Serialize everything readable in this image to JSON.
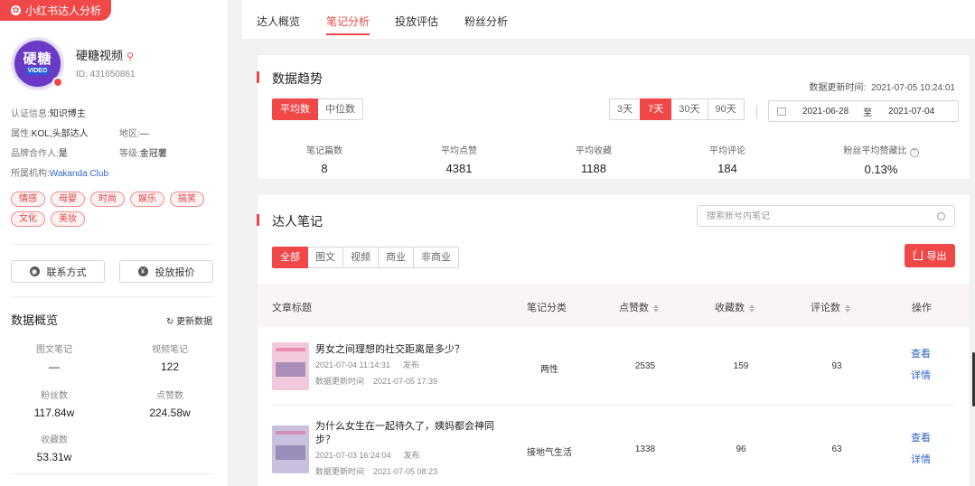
{
  "app": {
    "tag": "小红书达人分析"
  },
  "profile": {
    "avatar_text": "硬糖",
    "avatar_sub": "VIDEO",
    "name": "硬糖视频",
    "id": "ID: 431650861",
    "cert_label": "认证信息:",
    "cert_value": "知识博主",
    "attr_label": "属性:",
    "attr_value": "KOL,头部达人",
    "region_label": "地区:",
    "region_value": "—",
    "partner_label": "品牌合作人:",
    "partner_value": "是",
    "level_label": "等级:",
    "level_value": "金冠薯",
    "org_label": "所属机构:",
    "org_value": "Wakanda Club",
    "tags": [
      "情感",
      "母婴",
      "时尚",
      "娱乐",
      "搞笑",
      "文化",
      "美妆"
    ],
    "contact_button": "联系方式",
    "price_button": "投放报价"
  },
  "overview": {
    "title": "数据概览",
    "refresh": "更新数据",
    "stats": [
      {
        "label": "图文笔记",
        "value": "—"
      },
      {
        "label": "视频笔记",
        "value": "122"
      },
      {
        "label": "粉丝数",
        "value": "117.84w"
      },
      {
        "label": "点赞数",
        "value": "224.58w"
      },
      {
        "label": "收藏数",
        "value": "53.31w"
      }
    ]
  },
  "tabs": [
    "达人概览",
    "笔记分析",
    "投放评估",
    "粉丝分析"
  ],
  "trend": {
    "title": "数据趋势",
    "update_label": "数据更新时间:",
    "update_time": "2021-07-05 10:24:01",
    "modes": [
      "平均数",
      "中位数"
    ],
    "ranges": [
      "3天",
      "7天",
      "30天",
      "90天"
    ],
    "date_start": "2021-06-28",
    "date_to": "至",
    "date_end": "2021-07-04",
    "metrics": [
      {
        "label": "笔记篇数",
        "value": "8"
      },
      {
        "label": "平均点赞",
        "value": "4381"
      },
      {
        "label": "平均收藏",
        "value": "1188"
      },
      {
        "label": "平均评论",
        "value": "184"
      },
      {
        "label": "粉丝平均赞藏比",
        "value": "0.13%"
      }
    ]
  },
  "notes": {
    "title": "达人笔记",
    "search_placeholder": "搜索账号内笔记",
    "filters": [
      "全部",
      "图文",
      "视频",
      "商业",
      "非商业"
    ],
    "export": "导出",
    "headers": {
      "title": "文章标题",
      "category": "笔记分类",
      "likes": "点赞数",
      "collects": "收藏数",
      "comments": "评论数",
      "action": "操作"
    },
    "rows": [
      {
        "title": "男女之间理想的社交距离是多少？",
        "publish_time": "2021-07-04 11:14:31",
        "publish_label": "发布",
        "update_label": "数据更新时间",
        "update_time": "2021-07-05 17:39",
        "category": "两性",
        "likes": "2535",
        "collects": "159",
        "comments": "93",
        "action1": "查看",
        "action2": "详情"
      },
      {
        "title": "为什么女生在一起待久了，姨妈都会神同步？",
        "publish_time": "2021-07-03 16:24:04",
        "publish_label": "发布",
        "update_label": "数据更新时间",
        "update_time": "2021-07-05 08:23",
        "category": "接地气生活",
        "likes": "1338",
        "collects": "96",
        "comments": "63",
        "action1": "查看",
        "action2": "详情"
      }
    ]
  },
  "colors": {
    "accent": "#f04848",
    "link": "#2e63c9"
  }
}
